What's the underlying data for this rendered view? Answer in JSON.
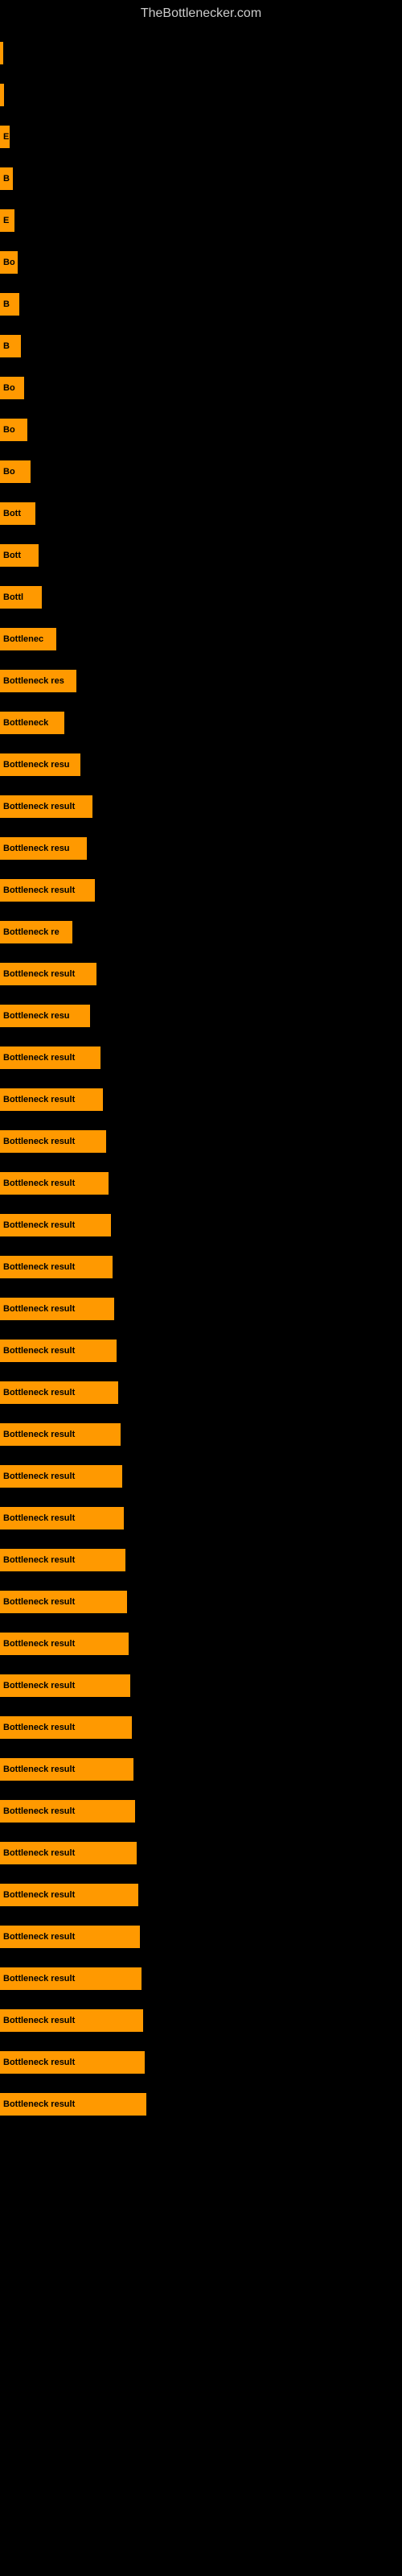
{
  "site": {
    "title": "TheBottlenecker.com"
  },
  "bars": [
    {
      "label": "",
      "width": 4
    },
    {
      "label": "",
      "width": 5
    },
    {
      "label": "E",
      "width": 12
    },
    {
      "label": "B",
      "width": 16
    },
    {
      "label": "E",
      "width": 18
    },
    {
      "label": "Bo",
      "width": 22
    },
    {
      "label": "B",
      "width": 24
    },
    {
      "label": "B",
      "width": 26
    },
    {
      "label": "Bo",
      "width": 30
    },
    {
      "label": "Bo",
      "width": 34
    },
    {
      "label": "Bo",
      "width": 38
    },
    {
      "label": "Bott",
      "width": 44
    },
    {
      "label": "Bott",
      "width": 48
    },
    {
      "label": "Bottl",
      "width": 52
    },
    {
      "label": "Bottlenec",
      "width": 70
    },
    {
      "label": "Bottleneck res",
      "width": 95
    },
    {
      "label": "Bottleneck",
      "width": 80
    },
    {
      "label": "Bottleneck resu",
      "width": 100
    },
    {
      "label": "Bottleneck result",
      "width": 115
    },
    {
      "label": "Bottleneck resu",
      "width": 108
    },
    {
      "label": "Bottleneck result",
      "width": 118
    },
    {
      "label": "Bottleneck re",
      "width": 90
    },
    {
      "label": "Bottleneck result",
      "width": 120
    },
    {
      "label": "Bottleneck resu",
      "width": 112
    },
    {
      "label": "Bottleneck result",
      "width": 125
    },
    {
      "label": "Bottleneck result",
      "width": 128
    },
    {
      "label": "Bottleneck result",
      "width": 132
    },
    {
      "label": "Bottleneck result",
      "width": 135
    },
    {
      "label": "Bottleneck result",
      "width": 138
    },
    {
      "label": "Bottleneck result",
      "width": 140
    },
    {
      "label": "Bottleneck result",
      "width": 142
    },
    {
      "label": "Bottleneck result",
      "width": 145
    },
    {
      "label": "Bottleneck result",
      "width": 147
    },
    {
      "label": "Bottleneck result",
      "width": 150
    },
    {
      "label": "Bottleneck result",
      "width": 152
    },
    {
      "label": "Bottleneck result",
      "width": 154
    },
    {
      "label": "Bottleneck result",
      "width": 156
    },
    {
      "label": "Bottleneck result",
      "width": 158
    },
    {
      "label": "Bottleneck result",
      "width": 160
    },
    {
      "label": "Bottleneck result",
      "width": 162
    },
    {
      "label": "Bottleneck result",
      "width": 164
    },
    {
      "label": "Bottleneck result",
      "width": 166
    },
    {
      "label": "Bottleneck result",
      "width": 168
    },
    {
      "label": "Bottleneck result",
      "width": 170
    },
    {
      "label": "Bottleneck result",
      "width": 172
    },
    {
      "label": "Bottleneck result",
      "width": 174
    },
    {
      "label": "Bottleneck result",
      "width": 176
    },
    {
      "label": "Bottleneck result",
      "width": 178
    },
    {
      "label": "Bottleneck result",
      "width": 180
    },
    {
      "label": "Bottleneck result",
      "width": 182
    }
  ]
}
